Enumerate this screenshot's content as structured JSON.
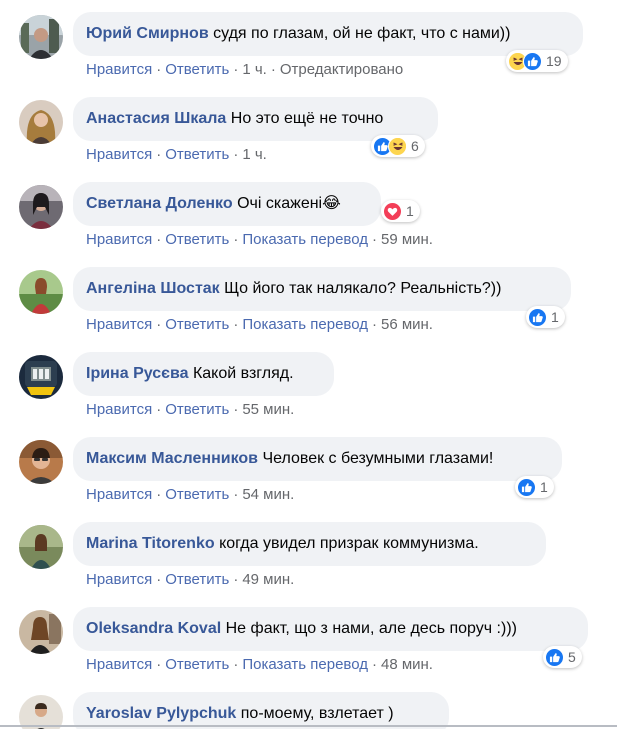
{
  "actions": {
    "like": "Нравится",
    "reply": "Ответить",
    "translate": "Показать перевод"
  },
  "colors": {
    "name": "#385898",
    "action": "#4b6ab0",
    "meta": "#65676b",
    "bubble": "#f0f2f5",
    "like": "#1877f2",
    "love": "#f33e58",
    "haha": "#fdd54f"
  },
  "comments": [
    {
      "author": "Юрий Смирнов",
      "text": "судя по глазам, ой не факт, что с нами))",
      "time": "1 ч.",
      "edited": "Отредактировано",
      "reactions": [
        "haha",
        "like"
      ],
      "count": "19"
    },
    {
      "author": "Анастасия Шкала",
      "text": "Но это ещё не точно",
      "time": "1 ч.",
      "reactions": [
        "like",
        "haha"
      ],
      "count": "6"
    },
    {
      "author": "Светлана Доленко",
      "text": "Очі скажені😂",
      "time": "59 мин.",
      "translate": true,
      "reactions": [
        "love"
      ],
      "count": "1"
    },
    {
      "author": "Ангеліна Шостак",
      "text": "Що його так налякало? Реальність?))",
      "time": "56 мин.",
      "translate": true,
      "reactions": [
        "like"
      ],
      "count": "1"
    },
    {
      "author": "Ірина Русєва",
      "text": "Какой взгляд.",
      "time": "55 мин."
    },
    {
      "author": "Максим Масленников",
      "text": "Человек с безумными глазами!",
      "time": "54 мин.",
      "reactions": [
        "like"
      ],
      "count": "1"
    },
    {
      "author": "Marina Titorenko",
      "text": "когда увидел призрак коммунизма.",
      "time": "49 мин."
    },
    {
      "author": "Oleksandra Koval",
      "text": "Не факт, що з нами, але десь поруч :)))",
      "time": "48 мин.",
      "translate": true,
      "reactions": [
        "like"
      ],
      "count": "5"
    },
    {
      "author": "Yaroslav Pylypchuk",
      "text": "по-моему, взлетает )"
    }
  ]
}
